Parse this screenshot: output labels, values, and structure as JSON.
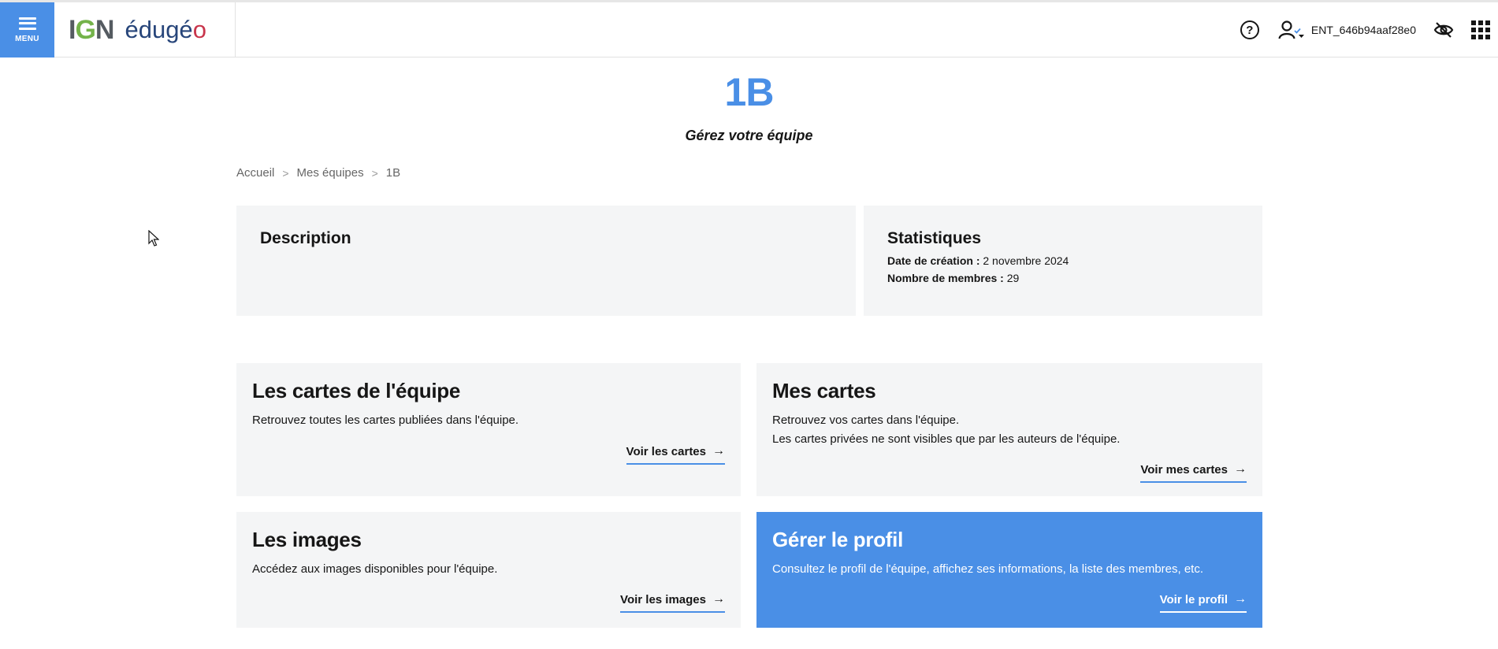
{
  "header": {
    "menu_label": "MENU",
    "logo_ign": "IGN",
    "logo_product": "édugéo",
    "user_name": "ENT_646b94aaf28e0",
    "help_glyph": "?"
  },
  "page": {
    "title": "1B",
    "subtitle": "Gérez votre équipe"
  },
  "breadcrumb": {
    "items": [
      "Accueil",
      "Mes équipes",
      "1B"
    ]
  },
  "description": {
    "title": "Description"
  },
  "statistics": {
    "title": "Statistiques",
    "creation_label": "Date de création :",
    "creation_value": "2 novembre 2024",
    "members_label": "Nombre de membres :",
    "members_value": "29"
  },
  "cards": [
    {
      "title": "Les cartes de l'équipe",
      "text": "Retrouvez toutes les cartes publiées dans l'équipe.",
      "link": "Voir les cartes"
    },
    {
      "title": "Mes cartes",
      "text": "Retrouvez vos cartes dans l'équipe.",
      "text2": "Les cartes privées ne sont visibles que par les auteurs de l'équipe.",
      "link": "Voir mes cartes"
    },
    {
      "title": "Les images",
      "text": "Accédez aux images disponibles pour l'équipe.",
      "link": "Voir les images"
    },
    {
      "title": "Gérer le profil",
      "text": "Consultez le profil de l'équipe, affichez ses informations, la liste des membres, etc.",
      "link": "Voir le profil"
    }
  ],
  "colors": {
    "accent": "#4a8fe6",
    "panel_bg": "#f4f5f6",
    "text": "#161616"
  },
  "icons": [
    "menu-icon",
    "help-icon",
    "user-icon",
    "chevron-down-icon",
    "eye-off-icon",
    "apps-grid-icon",
    "arrow-right-icon",
    "chevron-right-icon",
    "mouse-cursor-icon"
  ]
}
